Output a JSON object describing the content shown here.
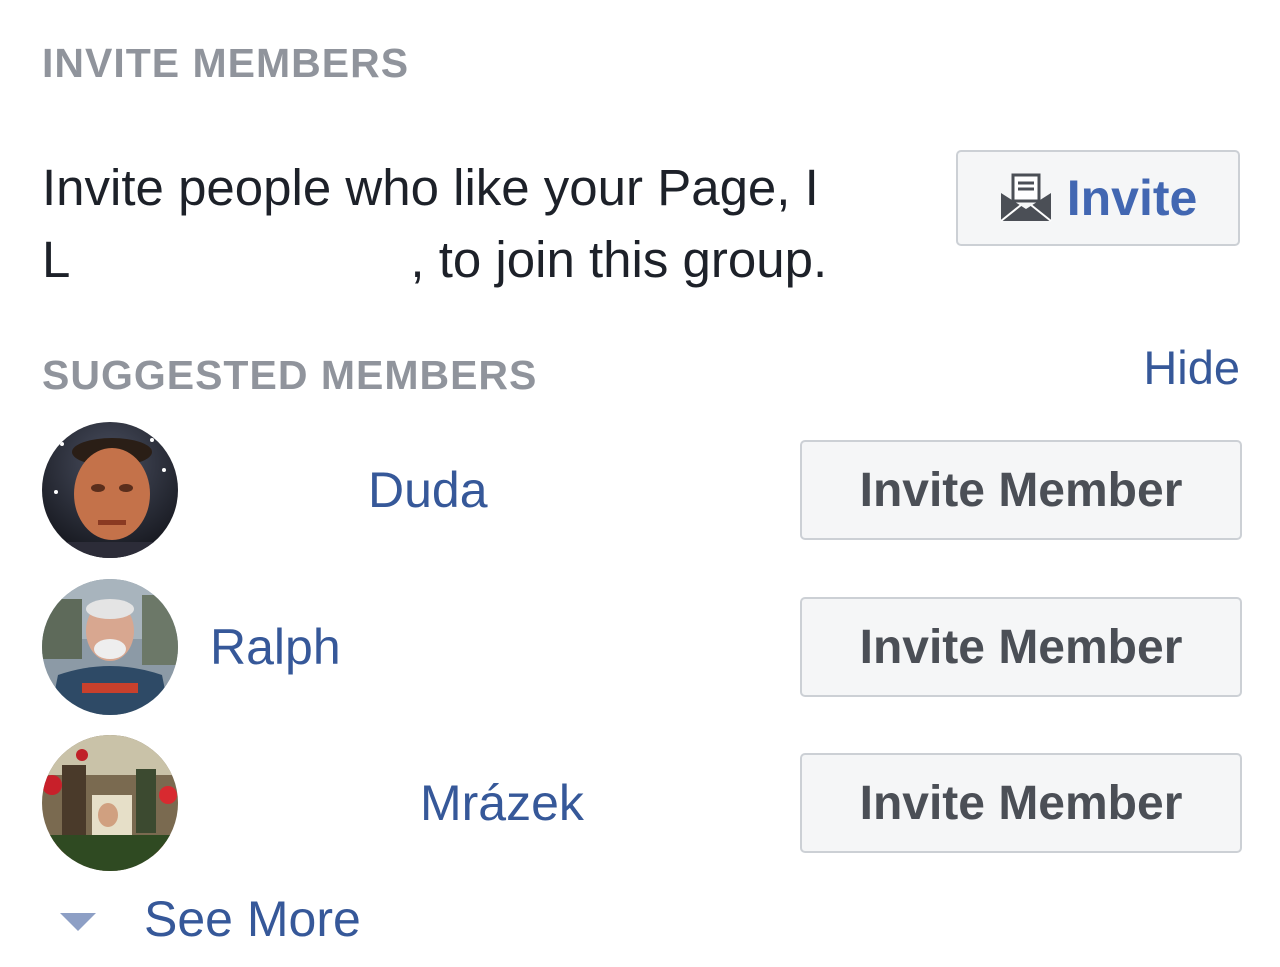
{
  "invite_section": {
    "heading": "INVITE MEMBERS",
    "description_line1": "Invite people who like your Page, I",
    "description_line2_start": "L",
    "description_line2_end": ", to join this group.",
    "invite_button_label": "Invite",
    "invite_icon": "envelope-invite-icon"
  },
  "suggested_section": {
    "heading": "SUGGESTED MEMBERS",
    "hide_label": "Hide",
    "members": [
      {
        "name": "Duda",
        "button_label": "Invite Member"
      },
      {
        "name": "Ralph",
        "button_label": "Invite Member"
      },
      {
        "name": "Mrázek",
        "button_label": "Invite Member"
      }
    ],
    "see_more_label": "See More",
    "see_more_icon": "caret-down-icon"
  },
  "colors": {
    "heading_gray": "#90949c",
    "link_blue": "#365899",
    "button_blue_text": "#4267b2",
    "button_bg": "#f5f6f7",
    "button_border": "#ccd0d5",
    "body_text": "#1d2129",
    "caret": "#8d9fc5"
  }
}
